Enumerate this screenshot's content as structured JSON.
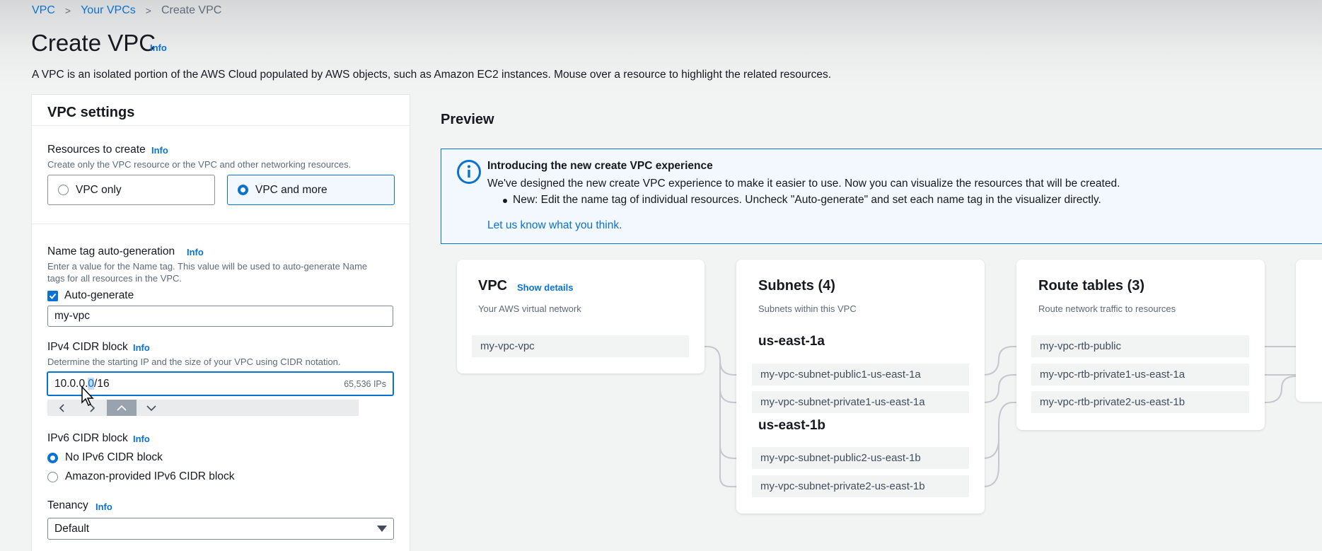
{
  "breadcrumb": {
    "items": [
      "VPC",
      "Your VPCs"
    ],
    "current": "Create VPC",
    "separator": ">"
  },
  "header": {
    "title": "Create VPC",
    "info": "Info",
    "description": "A VPC is an isolated portion of the AWS Cloud populated by AWS objects, such as Amazon EC2 instances. Mouse over a resource to highlight the related resources."
  },
  "settings": {
    "title": "VPC settings",
    "resources": {
      "label": "Resources to create",
      "info": "Info",
      "description": "Create only the VPC resource or the VPC and other networking resources.",
      "options": [
        "VPC only",
        "VPC and more"
      ],
      "selected": "VPC and more"
    },
    "name_tag": {
      "label": "Name tag auto-generation",
      "info": "Info",
      "description_line1": "Enter a value for the Name tag. This value will be used to auto-generate Name",
      "description_line2": "tags for all resources in the VPC.",
      "checkbox_label": "Auto-generate",
      "checked": true,
      "value": "my-vpc"
    },
    "ipv4": {
      "label": "IPv4 CIDR block",
      "info": "Info",
      "description": "Determine the starting IP and the size of your VPC using CIDR notation.",
      "value_before": "10.0.0.",
      "value_selected": "0",
      "value_after": "/16",
      "ip_count": "65,536 IPs"
    },
    "ipv6": {
      "label": "IPv6 CIDR block",
      "info": "Info",
      "options": [
        "No IPv6 CIDR block",
        "Amazon-provided IPv6 CIDR block"
      ],
      "selected": "No IPv6 CIDR block"
    },
    "tenancy": {
      "label": "Tenancy",
      "info": "Info",
      "value": "Default"
    }
  },
  "preview": {
    "title": "Preview",
    "flash": {
      "title": "Introducing the new create VPC experience",
      "text": "We've designed the new create VPC experience to make it easier to use. Now you can visualize the resources that will be created.",
      "bullet": "New: Edit the name tag of individual resources. Uncheck \"Auto-generate\" and set each name tag in the visualizer directly.",
      "link": "Let us know what you think."
    },
    "vpc_card": {
      "title": "VPC",
      "show_details": "Show details",
      "subtitle": "Your AWS virtual network",
      "resource": "my-vpc-vpc"
    },
    "subnets_card": {
      "title": "Subnets (4)",
      "subtitle": "Subnets within this VPC",
      "az1": "us-east-1a",
      "az1_subnets": [
        "my-vpc-subnet-public1-us-east-1a",
        "my-vpc-subnet-private1-us-east-1a"
      ],
      "az2": "us-east-1b",
      "az2_subnets": [
        "my-vpc-subnet-public2-us-east-1b",
        "my-vpc-subnet-private2-us-east-1b"
      ]
    },
    "route_card": {
      "title": "Route tables (3)",
      "subtitle": "Route network traffic to resources",
      "tables": [
        "my-vpc-rtb-public",
        "my-vpc-rtb-private1-us-east-1a",
        "my-vpc-rtb-private2-us-east-1b"
      ]
    }
  },
  "icons": {
    "info": "info-circle-icon",
    "checkbox": "check-icon",
    "dropdown": "caret-down-icon",
    "cursor": "mouse-cursor-icon"
  },
  "colors": {
    "accent": "#0972d3",
    "background": "#f2f3f3",
    "flash_bg": "#f2f8fd",
    "connector": "#c6c6cd"
  }
}
